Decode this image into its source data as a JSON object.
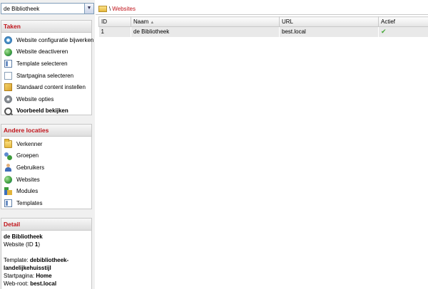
{
  "site_select": {
    "value": "de Bibliotheek"
  },
  "taken": {
    "title": "Taken",
    "items": [
      {
        "label": "Website configuratie bijwerken",
        "icon": "gear-icon"
      },
      {
        "label": "Website deactiveren",
        "icon": "globe-icon"
      },
      {
        "label": "Template selecteren",
        "icon": "template-icon"
      },
      {
        "label": "Startpagina selecteren",
        "icon": "page-icon"
      },
      {
        "label": "Standaard content instellen",
        "icon": "box-icon"
      },
      {
        "label": "Website opties",
        "icon": "cog-icon"
      },
      {
        "label": "Voorbeeld bekijken",
        "icon": "magnifier-icon"
      }
    ]
  },
  "andere": {
    "title": "Andere locaties",
    "items": [
      {
        "label": "Verkenner",
        "icon": "folder-icon"
      },
      {
        "label": "Groepen",
        "icon": "users-icon"
      },
      {
        "label": "Gebruikers",
        "icon": "user-icon"
      },
      {
        "label": "Websites",
        "icon": "globe-icon"
      },
      {
        "label": "Modules",
        "icon": "modules-icon"
      },
      {
        "label": "Templates",
        "icon": "template-icon"
      }
    ]
  },
  "detail": {
    "title": "Detail",
    "name": "de Bibliotheek",
    "type_prefix": "Website (ID ",
    "id": "1",
    "type_suffix": ")",
    "template_label": "Template: ",
    "template_value": "debibliotheek-landelijkehuisstijl",
    "startpagina_label": "Startpagina: ",
    "startpagina_value": "Home",
    "webroot_label": "Web-root: ",
    "webroot_value": "best.local"
  },
  "breadcrumb": {
    "separator": "\\",
    "current": "Websites"
  },
  "grid": {
    "columns": {
      "id": "ID",
      "naam": "Naam",
      "url": "URL",
      "actief": "Actief"
    },
    "sort_indicator": "▲",
    "rows": [
      {
        "id": "1",
        "naam": "de Bibliotheek",
        "url": "best.local",
        "actief": "✔"
      }
    ]
  }
}
